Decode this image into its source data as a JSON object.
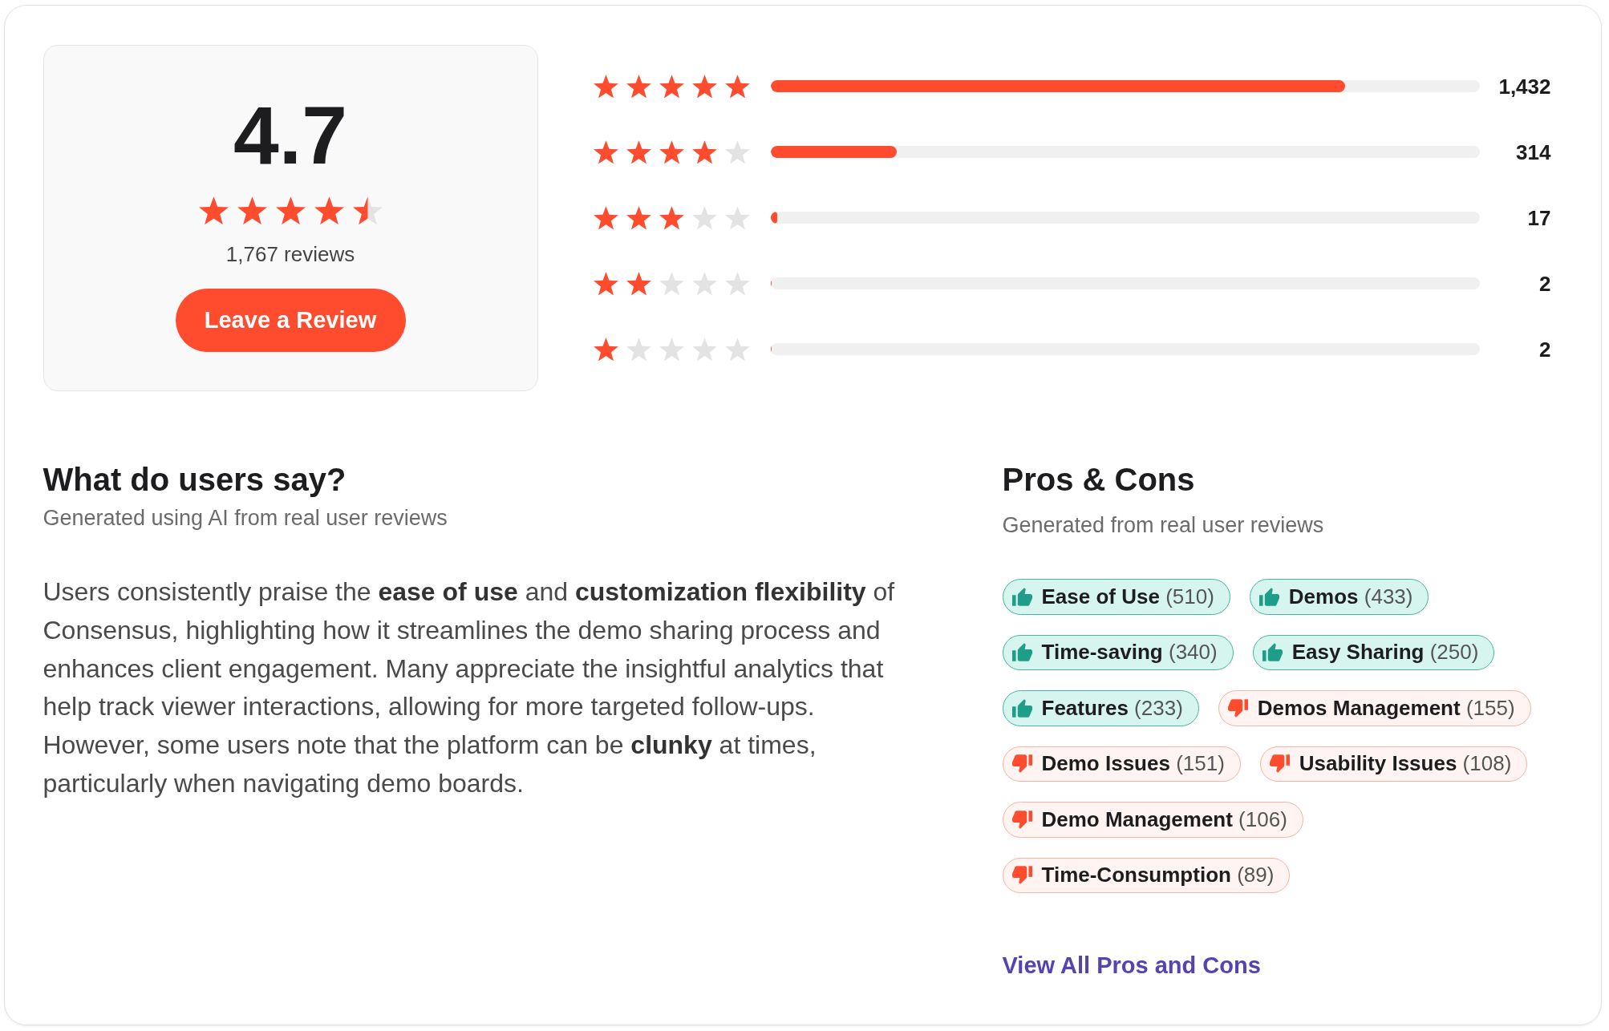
{
  "rating_summary": {
    "score": "4.7",
    "stars": 4.5,
    "review_count": "1,767 reviews",
    "button": "Leave a Review"
  },
  "rating_breakdown": [
    {
      "stars": 5,
      "level": 0.81,
      "count": "1,432"
    },
    {
      "stars": 4,
      "level": 0.178,
      "count": "314"
    },
    {
      "stars": 3,
      "level": 0.01,
      "count": "17"
    },
    {
      "stars": 2,
      "level": 0.001,
      "count": "2"
    },
    {
      "stars": 1,
      "level": 0.001,
      "count": "2"
    }
  ],
  "user_summary": {
    "title": "What do users say?",
    "subtitle": "Generated using AI from real user reviews",
    "text": "Users consistently praise the **ease of use** and **customization flexibility** of Consensus, highlighting how it streamlines the demo sharing process and enhances client engagement. Many appreciate the insightful analytics that help track viewer interactions, allowing for more targeted follow-ups. However, some users note that the platform can be **clunky** at times, particularly when navigating demo boards."
  },
  "pros_cons": {
    "title": "Pros & Cons",
    "subtitle": "Generated from real user reviews",
    "tags": [
      {
        "kind": "pro",
        "label": "Ease of Use",
        "count": "(510)"
      },
      {
        "kind": "pro",
        "label": "Demos",
        "count": "(433)"
      },
      {
        "kind": "pro",
        "label": "Time-saving",
        "count": "(340)"
      },
      {
        "kind": "pro",
        "label": "Easy Sharing",
        "count": "(250)"
      },
      {
        "kind": "pro",
        "label": "Features",
        "count": "(233)"
      },
      {
        "kind": "con",
        "label": "Demos Management",
        "count": "(155)"
      },
      {
        "kind": "con",
        "label": "Demo Issues",
        "count": "(151)"
      },
      {
        "kind": "con",
        "label": "Usability Issues",
        "count": "(108)"
      },
      {
        "kind": "con",
        "label": "Demo Management",
        "count": "(106)"
      },
      {
        "kind": "con",
        "label": "Time-Consumption",
        "count": "(89)"
      }
    ],
    "link": "View All Pros and Cons"
  }
}
